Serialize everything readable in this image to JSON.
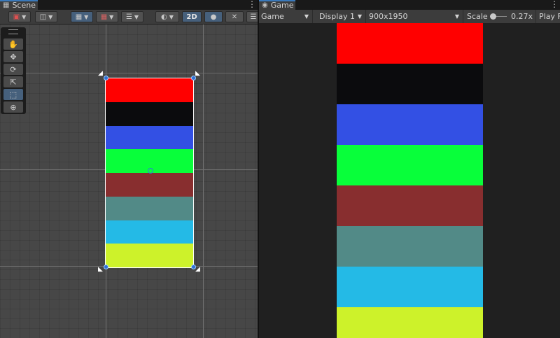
{
  "scene_panel": {
    "tab_label": "Scene",
    "tab_icon": "grid-icon",
    "mode_2d_label": "2D",
    "tools": [
      "hand-tool",
      "move-tool",
      "rotate-tool",
      "scale-tool",
      "rect-tool",
      "transform-tool"
    ],
    "sprite_stripes": [
      "#ff0000",
      "#0b0b0d",
      "#3350e4",
      "#08ff3a",
      "#882e2f",
      "#528a87",
      "#24bae6",
      "#cdf22a"
    ]
  },
  "game_panel": {
    "tab_label": "Game",
    "tab_icon": "gamepad-icon",
    "view_select": "Game",
    "display_select": "Display 1",
    "resolution_select": "900x1950",
    "scale_label": "Scale",
    "scale_value": "0.27x",
    "play_label": "Play F",
    "image_stripes": [
      "#ff0000",
      "#0b0b0d",
      "#3350e4",
      "#08ff3a",
      "#882e2f",
      "#528a87",
      "#24bae6",
      "#cdf22a"
    ]
  }
}
